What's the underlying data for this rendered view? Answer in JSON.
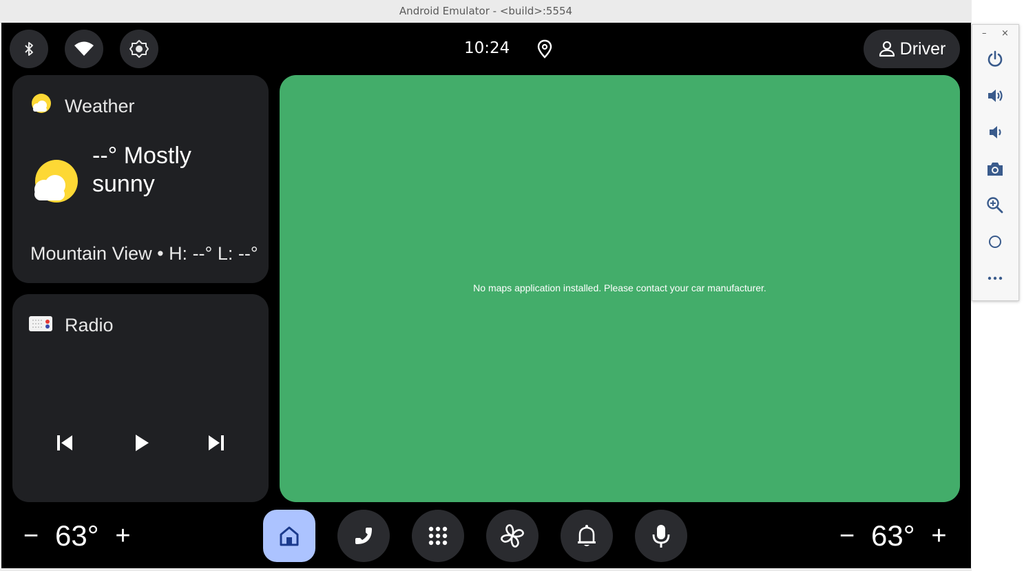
{
  "window": {
    "title": "Android Emulator - <build>:5554"
  },
  "status_bar": {
    "time": "10:24",
    "profile_label": "Driver"
  },
  "weather_card": {
    "title": "Weather",
    "condition": "--° Mostly sunny",
    "location_line": "Mountain View • H: --° L: --°"
  },
  "radio_card": {
    "title": "Radio"
  },
  "map": {
    "message": "No maps application installed. Please contact your car manufacturer."
  },
  "hvac": {
    "left": {
      "minus": "−",
      "temp": "63°",
      "plus": "+"
    },
    "right": {
      "minus": "−",
      "temp": "63°",
      "plus": "+"
    }
  },
  "dock": {
    "items": [
      "home-icon",
      "phone-icon",
      "app-grid-icon",
      "fan-icon",
      "bell-icon",
      "mic-icon"
    ],
    "active": "home-icon"
  },
  "emulator_controls": {
    "window_buttons": {
      "minimize": "–",
      "close": "×"
    },
    "items": [
      "power-icon",
      "volume-up-icon",
      "volume-down-icon",
      "camera-icon",
      "zoom-icon",
      "home-circle-icon",
      "more-icon"
    ]
  },
  "colors": {
    "accent_active": "#acc3ff",
    "map_bg": "#43ad6a",
    "card_bg": "#1f2023",
    "button_bg": "#2a2b2f"
  }
}
